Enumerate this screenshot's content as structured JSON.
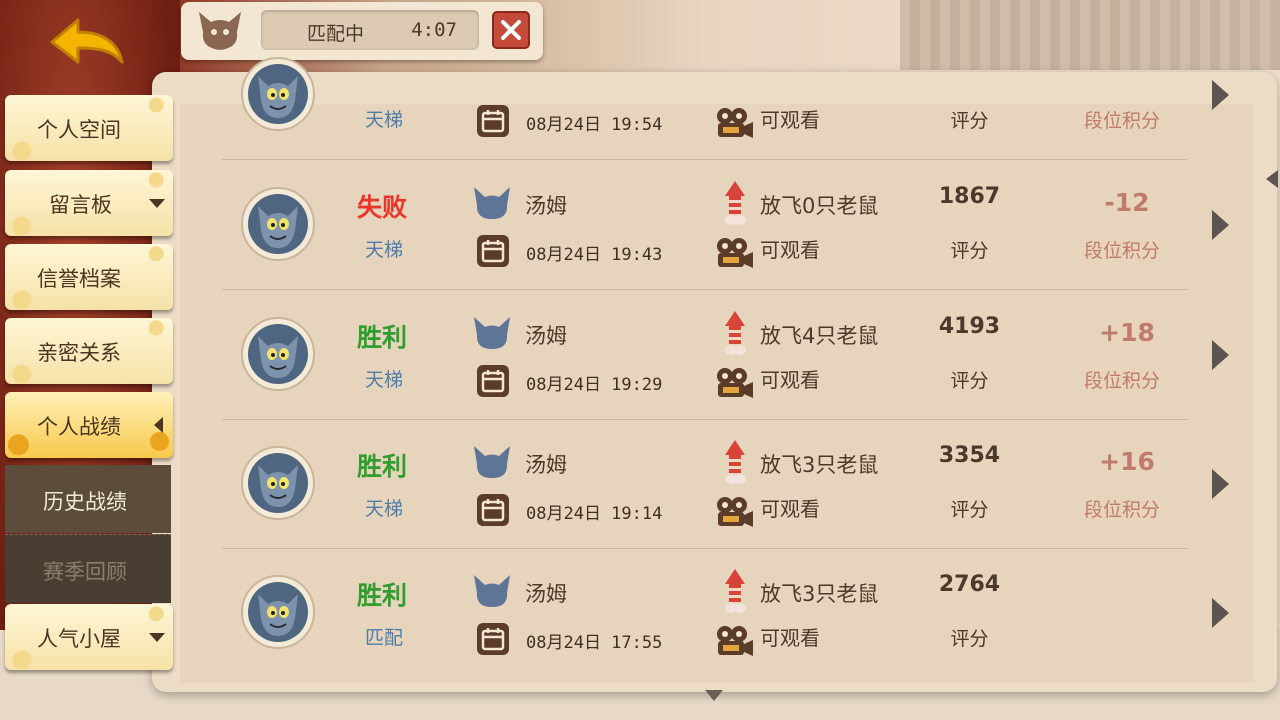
{
  "match": {
    "status": "匹配中",
    "timer": "4:07"
  },
  "sidebar": {
    "items": [
      {
        "label": "个人空间"
      },
      {
        "label": "留言板"
      },
      {
        "label": "信誉档案"
      },
      {
        "label": "亲密关系"
      },
      {
        "label": "个人战绩"
      },
      {
        "label": "人气小屋"
      }
    ],
    "sub_items": [
      {
        "label": "历史战绩"
      },
      {
        "label": "赛季回顾"
      }
    ]
  },
  "rows": [
    {
      "result": "",
      "result_color": "",
      "mode": "天梯",
      "character": "",
      "date": "08月24日 19:54",
      "mice": "",
      "watch": "可观看",
      "score": "",
      "score_label": "评分",
      "delta": "",
      "delta_label": "段位积分"
    },
    {
      "result": "失败",
      "result_color": "#e8372a",
      "mode": "天梯",
      "character": "汤姆",
      "date": "08月24日 19:43",
      "mice": "放飞0只老鼠",
      "watch": "可观看",
      "score": "1867",
      "score_label": "评分",
      "delta": "-12",
      "delta_label": "段位积分"
    },
    {
      "result": "胜利",
      "result_color": "#2f9e2f",
      "mode": "天梯",
      "character": "汤姆",
      "date": "08月24日 19:29",
      "mice": "放飞4只老鼠",
      "watch": "可观看",
      "score": "4193",
      "score_label": "评分",
      "delta": "+18",
      "delta_label": "段位积分"
    },
    {
      "result": "胜利",
      "result_color": "#2f9e2f",
      "mode": "天梯",
      "character": "汤姆",
      "date": "08月24日 19:14",
      "mice": "放飞3只老鼠",
      "watch": "可观看",
      "score": "3354",
      "score_label": "评分",
      "delta": "+16",
      "delta_label": "段位积分"
    },
    {
      "result": "胜利",
      "result_color": "#2f9e2f",
      "mode": "匹配",
      "character": "汤姆",
      "date": "08月24日 17:55",
      "mice": "放飞3只老鼠",
      "watch": "可观看",
      "score": "2764",
      "score_label": "评分",
      "delta": "",
      "delta_label": ""
    }
  ],
  "icons": {
    "back": "back-arrow-icon",
    "cat_head": "tom-head-icon",
    "close": "close-icon",
    "avatar": "tom-avatar-icon",
    "calendar": "calendar-icon",
    "rocket": "rocket-icon",
    "camera": "camera-icon",
    "arrow": "chevron-right-icon"
  },
  "colors": {
    "accent": "#f7c94c",
    "loss": "#e8372a",
    "win": "#2f9e2f",
    "rank": "#c27a6c",
    "mode": "#4f7da8"
  }
}
